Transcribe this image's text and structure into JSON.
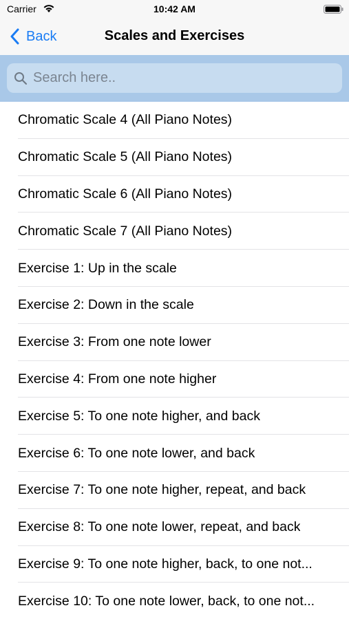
{
  "status_bar": {
    "carrier": "Carrier",
    "time": "10:42 AM",
    "wifi_icon": "wifi-icon",
    "battery_icon": "battery-icon"
  },
  "nav": {
    "back_label": "Back",
    "title": "Scales and Exercises"
  },
  "search": {
    "placeholder": "Search here..",
    "value": ""
  },
  "colors": {
    "accent": "#1a7cf4",
    "search_bar_bg": "#a9c8e8",
    "search_field_bg": "#c7dcf0"
  },
  "list": {
    "items": [
      "Chromatic Scale 4 (All Piano Notes)",
      "Chromatic Scale 5 (All Piano Notes)",
      "Chromatic Scale 6 (All Piano Notes)",
      "Chromatic Scale 7 (All Piano Notes)",
      "Exercise 1: Up in the scale",
      "Exercise 2: Down in the scale",
      "Exercise 3: From one note lower",
      "Exercise 4: From one note higher",
      "Exercise 5: To one note higher, and back",
      "Exercise 6: To one note lower, and back",
      "Exercise 7: To one note higher, repeat, and back",
      "Exercise 8: To one note lower, repeat, and back",
      "Exercise 9: To one note higher, back, to one not...",
      "Exercise 10: To one note lower, back, to one not..."
    ]
  }
}
